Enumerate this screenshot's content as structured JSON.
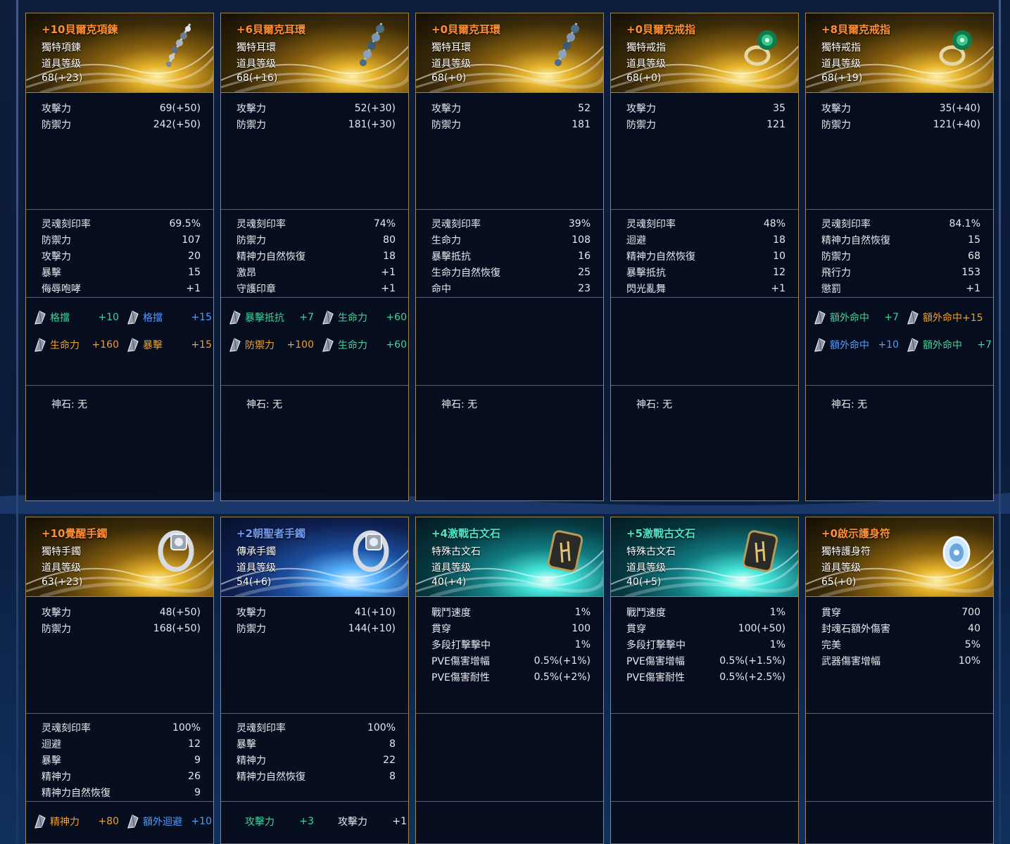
{
  "cards": [
    {
      "title": "+10貝爾克項鍊",
      "title_color": "#ff8e34",
      "theme": "gold",
      "icon": "necklace-icon",
      "type": "獨特項鍊",
      "level_label": "道具等级",
      "level": "68(+23)",
      "base": [
        {
          "k": "攻擊力",
          "v": "69(+50)"
        },
        {
          "k": "防禦力",
          "v": "242(+50)"
        }
      ],
      "soul": [
        {
          "k": "灵魂刻印率",
          "v": "69.5%"
        },
        {
          "k": "防禦力",
          "v": "107"
        },
        {
          "k": "攻擊力",
          "v": "20"
        },
        {
          "k": "暴擊",
          "v": "15"
        },
        {
          "k": "侮辱咆哮",
          "v": "+1"
        }
      ],
      "gems": [
        {
          "k": "格擋",
          "v": "+10",
          "color": "#40d49a"
        },
        {
          "k": "格擋",
          "v": "+15",
          "color": "#4f9dff"
        },
        {
          "k": "生命力",
          "v": "+160",
          "color": "#f0a02a"
        },
        {
          "k": "暴擊",
          "v": "+15",
          "color": "#f0a02a"
        }
      ],
      "stone": "神石: 无"
    },
    {
      "title": "+6貝爾克耳環",
      "title_color": "#ff8e34",
      "theme": "gold",
      "icon": "earring-icon",
      "type": "獨特耳環",
      "level_label": "道具等级",
      "level": "68(+16)",
      "base": [
        {
          "k": "攻擊力",
          "v": "52(+30)"
        },
        {
          "k": "防禦力",
          "v": "181(+30)"
        }
      ],
      "soul": [
        {
          "k": "灵魂刻印率",
          "v": "74%"
        },
        {
          "k": "防禦力",
          "v": "80"
        },
        {
          "k": "精神力自然恢復",
          "v": "18"
        },
        {
          "k": "激昂",
          "v": "+1"
        },
        {
          "k": "守護印章",
          "v": "+1"
        }
      ],
      "gems": [
        {
          "k": "暴擊抵抗",
          "v": "+7",
          "color": "#40d49a"
        },
        {
          "k": "生命力",
          "v": "+60",
          "color": "#40d49a"
        },
        {
          "k": "防禦力",
          "v": "+100",
          "color": "#f0a02a"
        },
        {
          "k": "生命力",
          "v": "+60",
          "color": "#40d49a"
        }
      ],
      "stone": "神石: 无"
    },
    {
      "title": "+0貝爾克耳環",
      "title_color": "#ff8e34",
      "theme": "gold",
      "icon": "earring-icon",
      "type": "獨特耳環",
      "level_label": "道具等级",
      "level": "68(+0)",
      "base": [
        {
          "k": "攻擊力",
          "v": "52"
        },
        {
          "k": "防禦力",
          "v": "181"
        }
      ],
      "soul": [
        {
          "k": "灵魂刻印率",
          "v": "39%"
        },
        {
          "k": "生命力",
          "v": "108"
        },
        {
          "k": "暴擊抵抗",
          "v": "16"
        },
        {
          "k": "生命力自然恢復",
          "v": "25"
        },
        {
          "k": "命中",
          "v": "23"
        }
      ],
      "gems": [],
      "stone": "神石: 无"
    },
    {
      "title": "+0貝爾克戒指",
      "title_color": "#ff8e34",
      "theme": "gold",
      "icon": "ring-icon",
      "type": "獨特戒指",
      "level_label": "道具等级",
      "level": "68(+0)",
      "base": [
        {
          "k": "攻擊力",
          "v": "35"
        },
        {
          "k": "防禦力",
          "v": "121"
        }
      ],
      "soul": [
        {
          "k": "灵魂刻印率",
          "v": "48%"
        },
        {
          "k": "迴避",
          "v": "18"
        },
        {
          "k": "精神力自然恢復",
          "v": "10"
        },
        {
          "k": "暴擊抵抗",
          "v": "12"
        },
        {
          "k": "閃光亂舞",
          "v": "+1"
        }
      ],
      "gems": [],
      "stone": "神石: 无"
    },
    {
      "title": "+8貝爾克戒指",
      "title_color": "#ff8e34",
      "theme": "gold",
      "icon": "ring-icon",
      "type": "獨特戒指",
      "level_label": "道具等级",
      "level": "68(+19)",
      "base": [
        {
          "k": "攻擊力",
          "v": "35(+40)"
        },
        {
          "k": "防禦力",
          "v": "121(+40)"
        }
      ],
      "soul": [
        {
          "k": "灵魂刻印率",
          "v": "84.1%"
        },
        {
          "k": "精神力自然恢復",
          "v": "15"
        },
        {
          "k": "防禦力",
          "v": "68"
        },
        {
          "k": "飛行力",
          "v": "153"
        },
        {
          "k": "懲罰",
          "v": "+1"
        }
      ],
      "gems": [
        {
          "k": "額外命中",
          "v": "+7",
          "color": "#40d49a"
        },
        {
          "k": "額外命中+15",
          "v": "",
          "color": "#f0a02a"
        },
        {
          "k": "額外命中",
          "v": "+10",
          "color": "#4f9dff"
        },
        {
          "k": "額外命中",
          "v": "+7",
          "color": "#40d49a"
        }
      ],
      "stone": "神石: 无"
    },
    {
      "title": "+10覺醒手鐲",
      "title_color": "#ff8e34",
      "theme": "gold",
      "icon": "bracelet-icon",
      "type": "獨特手鐲",
      "level_label": "道具等级",
      "level": "63(+23)",
      "base": [
        {
          "k": "攻擊力",
          "v": "48(+50)"
        },
        {
          "k": "防禦力",
          "v": "168(+50)"
        }
      ],
      "soul": [
        {
          "k": "灵魂刻印率",
          "v": "100%"
        },
        {
          "k": "迴避",
          "v": "12"
        },
        {
          "k": "暴擊",
          "v": "9"
        },
        {
          "k": "精神力",
          "v": "26"
        },
        {
          "k": "精神力自然恢復",
          "v": "9"
        }
      ],
      "gems": [
        {
          "k": "精神力",
          "v": "+80",
          "color": "#f0a02a"
        },
        {
          "k": "額外迴避",
          "v": "+10",
          "color": "#4f9dff"
        }
      ],
      "stone": ""
    },
    {
      "title": "+2朝聖者手鐲",
      "title_color": "#6d9cf2",
      "theme": "blue",
      "icon": "bracelet-icon",
      "type": "傳承手鐲",
      "level_label": "道具等级",
      "level": "54(+6)",
      "base": [
        {
          "k": "攻擊力",
          "v": "41(+10)"
        },
        {
          "k": "防禦力",
          "v": "144(+10)"
        }
      ],
      "soul": [
        {
          "k": "灵魂刻印率",
          "v": "100%"
        },
        {
          "k": "暴擊",
          "v": "8"
        },
        {
          "k": "精神力",
          "v": "22"
        },
        {
          "k": "精神力自然恢復",
          "v": "8"
        }
      ],
      "gems": [
        {
          "k": "攻擊力",
          "v": "+3",
          "color": "#40d49a"
        },
        {
          "k": "攻擊力",
          "v": "+1",
          "color": "#e8e9ee"
        }
      ],
      "stone": ""
    },
    {
      "title": "+4激戰古文石",
      "title_color": "#4ce5c9",
      "theme": "teal",
      "icon": "rune-stone-icon",
      "type": "特殊古文石",
      "level_label": "道具等级",
      "level": "40(+4)",
      "base": [
        {
          "k": "戰鬥速度",
          "v": "1%"
        },
        {
          "k": "貫穿",
          "v": "100"
        },
        {
          "k": "多段打擊擊中",
          "v": "1%"
        },
        {
          "k": "PVE傷害增幅",
          "v": "0.5%(+1%)"
        },
        {
          "k": "PVE傷害耐性",
          "v": "0.5%(+2%)"
        }
      ],
      "soul": [],
      "gems": [],
      "stone": ""
    },
    {
      "title": "+5激戰古文石",
      "title_color": "#4ce5c9",
      "theme": "teal",
      "icon": "rune-stone-icon",
      "type": "特殊古文石",
      "level_label": "道具等级",
      "level": "40(+5)",
      "base": [
        {
          "k": "戰鬥速度",
          "v": "1%"
        },
        {
          "k": "貫穿",
          "v": "100(+50)"
        },
        {
          "k": "多段打擊擊中",
          "v": "1%"
        },
        {
          "k": "PVE傷害增幅",
          "v": "0.5%(+1.5%)"
        },
        {
          "k": "PVE傷害耐性",
          "v": "0.5%(+2.5%)"
        }
      ],
      "soul": [],
      "gems": [],
      "stone": ""
    },
    {
      "title": "+0啟示護身符",
      "title_color": "#ff8e34",
      "theme": "gold",
      "icon": "amulet-icon",
      "type": "獨特護身符",
      "level_label": "道具等级",
      "level": "65(+0)",
      "base": [
        {
          "k": "貫穿",
          "v": "700"
        },
        {
          "k": "封魂石額外傷害",
          "v": "40"
        },
        {
          "k": "完美",
          "v": "5%"
        },
        {
          "k": "武器傷害增幅",
          "v": "10%"
        }
      ],
      "soul": [],
      "gems": [],
      "stone": ""
    }
  ]
}
